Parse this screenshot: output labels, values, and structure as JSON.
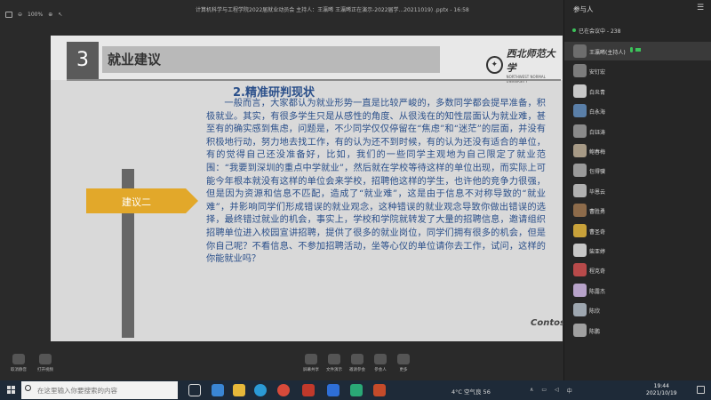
{
  "meeting": {
    "window_title": "计算机科学与工程学院2022届就业动员会  主持人：王瀛晞  王瀛晞正在演示-2022届学...20211019) .pptx - 16:58",
    "zoom": "100%",
    "tools": {
      "exit_label": "退出"
    }
  },
  "slide": {
    "number": "3",
    "header": "就业建议",
    "university": "西北师范大学",
    "university_en": "NORTHWEST NORMAL UNIVERSITY",
    "section_title": "2.精准研判现状",
    "body": "一般而言，大家都认为就业形势一直是比较严峻的，多数同学都会提早准备，积极就业。其实，有很多学生只是从感性的角度、从很浅在的知性层面认为就业难，甚至有的确实感到焦虑，问题是，不少同学仅仅停留在“焦虑”和“迷茫”的层面，并没有积极地行动，努力地去找工作，有的认为还不到时候，有的认为还没有适合的单位，有的觉得自己还没准备好，比如，我们的一些同学主观地为自己限定了就业范围：“我要到深圳的重点中学就业”，然后就在学校等待这样的单位出现，而实际上可能今年根本就没有这样的单位会来学校，招聘他这样的学生，也许他的竞争力很强，但是因为资源和信息不匹配，造成了“就业难”，这是由于信息不对称导致的“就业难”，并影响同学们形成错误的就业观念，这种错误的就业观念导致你做出错误的选择，最终错过就业的机会，事实上，学校和学院就转发了大量的招聘信息，邀请组织招聘单位进入校园宣讲招聘，提供了很多的就业岗位，同学们拥有很多的机会，但是你自己呢？不看信息、不参加招聘活动，坐等心仪的单位请你去工作，试问，这样的你能就业吗？",
    "sign_label": "建议二",
    "footer_logo": "Contos"
  },
  "bottom_bar": {
    "buttons": [
      {
        "label": "取消静音"
      },
      {
        "label": "打开视频"
      },
      {
        "label": "屏幕共享"
      },
      {
        "label": "文件演示"
      },
      {
        "label": "邀请参会"
      },
      {
        "label": "参会人"
      },
      {
        "label": "更多"
      }
    ]
  },
  "panel": {
    "title": "参与人",
    "in_meeting": "已在会议中 - 238",
    "participants": [
      {
        "name": "王瀛晞(主持人)",
        "host": true
      },
      {
        "name": "安钉宏"
      },
      {
        "name": "白炎青"
      },
      {
        "name": "白永海"
      },
      {
        "name": "白钰涛"
      },
      {
        "name": "鲍春梅"
      },
      {
        "name": "包得骥"
      },
      {
        "name": "毕恩云"
      },
      {
        "name": "曹胜勇"
      },
      {
        "name": "曹圣奇"
      },
      {
        "name": "柴亚婷"
      },
      {
        "name": "程克奇"
      },
      {
        "name": "陈露杰"
      },
      {
        "name": "陈欣"
      },
      {
        "name": "陈鹏"
      }
    ]
  },
  "taskbar": {
    "search_placeholder": "在这里输入你要搜索的内容",
    "weather": "4°C 空气良 56",
    "tray": [
      "∧",
      "中"
    ],
    "time": "19:44",
    "date": "2021/10/19"
  },
  "colors": {
    "slide_text": "#2a4f8a",
    "sign_fill": "#e2a82a",
    "taskbar": "#1e2a38",
    "active_green": "#3cc25a"
  }
}
